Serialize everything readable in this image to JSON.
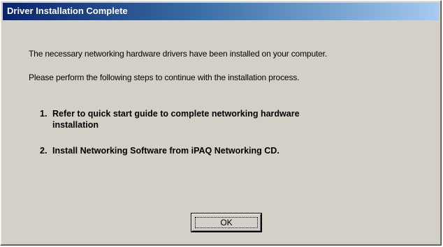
{
  "dialog": {
    "title": "Driver Installation Complete",
    "message_line1": "The necessary networking hardware drivers have been installed on your computer.",
    "message_line2": "Please perform the following steps to continue with the installation process.",
    "steps": [
      {
        "number": "1.",
        "text_line1": "Refer to quick start guide to complete networking hardware",
        "text_line2": "installation"
      },
      {
        "number": "2.",
        "text_line1": "Install Networking Software from iPAQ Networking CD."
      }
    ],
    "ok_label": "OK"
  },
  "colors": {
    "titlebar_start": "#0a246a",
    "titlebar_end": "#a6caf0",
    "dialog_face": "#d4d0c8"
  }
}
